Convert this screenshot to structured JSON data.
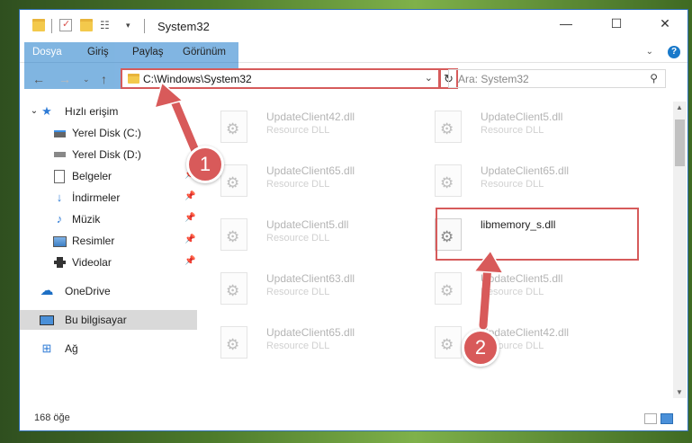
{
  "titlebar": {
    "title": "System32",
    "minimize": "—",
    "maximize": "☐",
    "close": "✕"
  },
  "ribbon": {
    "tabs": [
      "Dosya",
      "Giriş",
      "Paylaş",
      "Görünüm"
    ],
    "help": "?"
  },
  "navigation": {
    "address": "C:\\Windows\\System32",
    "search_placeholder": "Ara: System32"
  },
  "sidebar": {
    "items": [
      {
        "label": "Hızlı erişim",
        "icon": "star-icon"
      },
      {
        "label": "Yerel Disk (C:)",
        "icon": "drive-icon"
      },
      {
        "label": "Yerel Disk (D:)",
        "icon": "drive-icon"
      },
      {
        "label": "Belgeler",
        "icon": "documents-icon"
      },
      {
        "label": "İndirmeler",
        "icon": "download-icon"
      },
      {
        "label": "Müzik",
        "icon": "music-icon"
      },
      {
        "label": "Resimler",
        "icon": "pictures-icon"
      },
      {
        "label": "Videolar",
        "icon": "video-icon"
      },
      {
        "label": "OneDrive",
        "icon": "cloud-icon"
      },
      {
        "label": "Bu bilgisayar",
        "icon": "computer-icon"
      },
      {
        "label": "Ağ",
        "icon": "network-icon"
      }
    ]
  },
  "files": [
    {
      "name": "UpdateClient42.dll",
      "type": "Resource DLL"
    },
    {
      "name": "UpdateClient5.dll",
      "type": "Resource DLL"
    },
    {
      "name": "UpdateClient65.dll",
      "type": "Resource DLL"
    },
    {
      "name": "UpdateClient65.dll",
      "type": "Resource DLL"
    },
    {
      "name": "UpdateClient5.dll",
      "type": "Resource DLL"
    },
    {
      "name": "libmemory_s.dll",
      "type": ""
    },
    {
      "name": "UpdateClient63.dll",
      "type": "Resource DLL"
    },
    {
      "name": "UpdateClient5.dll",
      "type": "Resource DLL"
    },
    {
      "name": "UpdateClient65.dll",
      "type": "Resource DLL"
    },
    {
      "name": "UpdateClient42.dll",
      "type": "Resource DLL"
    }
  ],
  "status": {
    "count": "168 öğe"
  },
  "callouts": [
    "1",
    "2"
  ],
  "colors": {
    "accent": "#1979ca",
    "highlight": "#d65b5b"
  }
}
